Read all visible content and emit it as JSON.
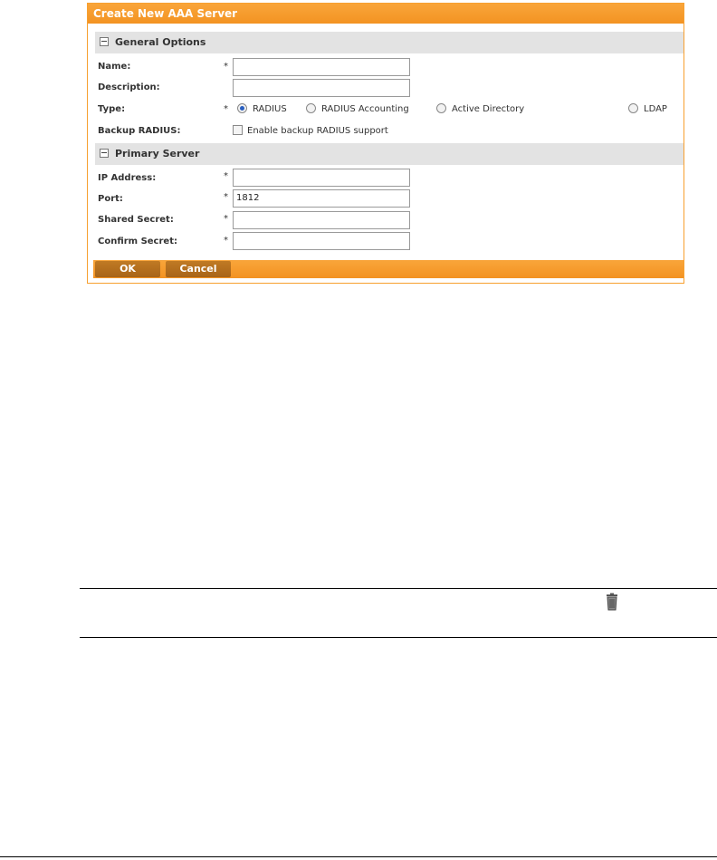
{
  "dialog": {
    "title": "Create New AAA Server",
    "general_section": "General Options",
    "primary_section": "Primary Server",
    "fields": {
      "name_label": "Name:",
      "description_label": "Description:",
      "type_label": "Type:",
      "backup_label": "Backup RADIUS:",
      "ip_label": "IP Address:",
      "port_label": "Port:",
      "secret_label": "Shared Secret:",
      "confirm_label": "Confirm Secret:",
      "required_mark": "*",
      "port_value": "1812"
    },
    "type_options": [
      "RADIUS",
      "RADIUS Accounting",
      "Active Directory",
      "LDAP"
    ],
    "type_selected": "RADIUS",
    "backup_checkbox_label": "Enable backup RADIUS support",
    "backup_checked": false,
    "ok_label": "OK",
    "cancel_label": "Cancel"
  },
  "icons": {
    "delete": "trash-icon"
  },
  "colors": {
    "accent": "#f39322",
    "button": "#b06b1c",
    "section_bg": "#e3e3e3"
  }
}
